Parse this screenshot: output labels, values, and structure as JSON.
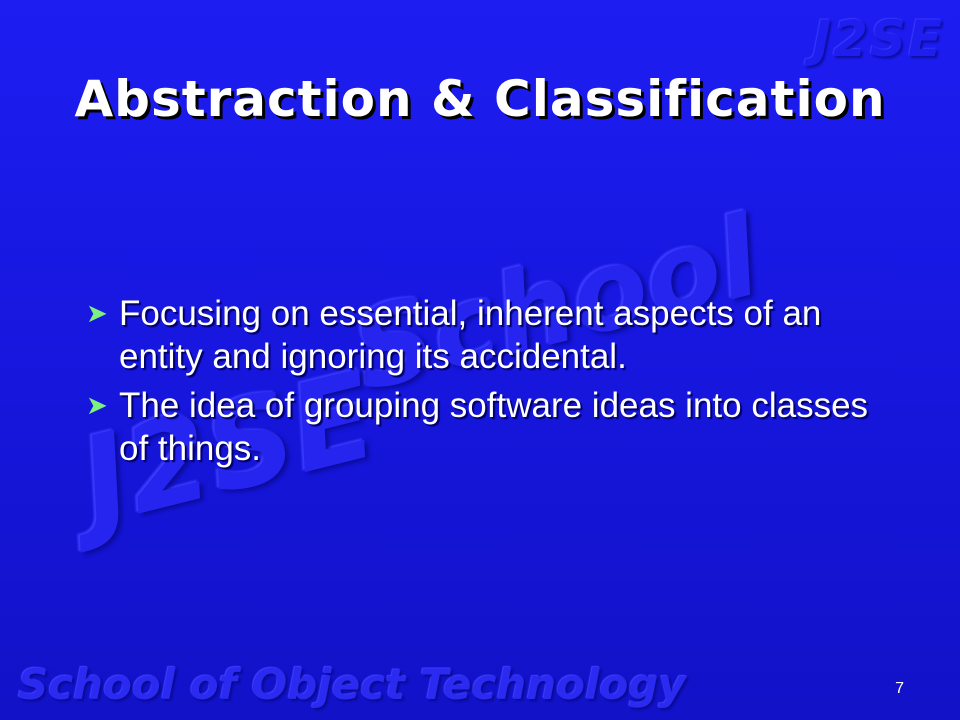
{
  "watermarks": {
    "corner": "J2SE",
    "center_top": "School",
    "center_bottom": "J2SE"
  },
  "slide": {
    "title": "Abstraction & Classification",
    "bullets": [
      {
        "icon": "arrow-bullet-icon",
        "text": "Focusing on essential, inherent aspects of an entity and ignoring its accidental."
      },
      {
        "icon": "arrow-bullet-icon",
        "text": "The idea of grouping software ideas into classes of things."
      }
    ],
    "footer_brand": "School of Object Technology",
    "page_number": "7"
  },
  "colors": {
    "background": "#1a1ae0",
    "title_text": "#ffffff",
    "bullet_icon": "#7ef07e",
    "watermark": "#2525ef"
  }
}
